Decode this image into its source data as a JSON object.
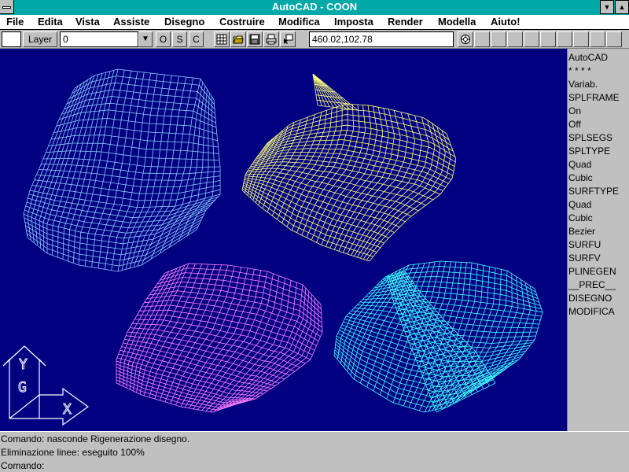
{
  "window": {
    "title": "AutoCAD - COON"
  },
  "menu": [
    "File",
    "Edita",
    "Vista",
    "Assiste",
    "Disegno",
    "Costruire",
    "Modifica",
    "Imposta",
    "Render",
    "Modella",
    "Aiuto!"
  ],
  "toolbar": {
    "layer_label": "Layer",
    "layer_value": "0",
    "ortho": "O",
    "snap": "S",
    "coords_toggle": "C",
    "coordinates": "460.02,102.78"
  },
  "side_menu": [
    "AutoCAD",
    "* * * *",
    "Variab.",
    "SPLFRAME",
    " On",
    " Off",
    "SPLSEGS",
    "SPLTYPE",
    " Quad",
    " Cubic",
    "SURFTYPE",
    " Quad",
    " Cubic",
    " Bezier",
    "SURFU",
    "SURFV",
    "PLINEGEN",
    "__PREC__",
    "DISEGNO",
    "MODIFICA"
  ],
  "command_lines": [
    "Comando: nasconde Rigenerazione disegno.",
    "Eliminazione linee: eseguito 100%",
    "Comando:"
  ],
  "ucs": {
    "y": "Y",
    "g": "G",
    "x": "X"
  },
  "colors": {
    "drawing_bg": "#000080",
    "surface1": "#8cc8ff",
    "surface2": "#ffff80",
    "surface3": "#ff80ff",
    "surface4": "#40ffff"
  }
}
